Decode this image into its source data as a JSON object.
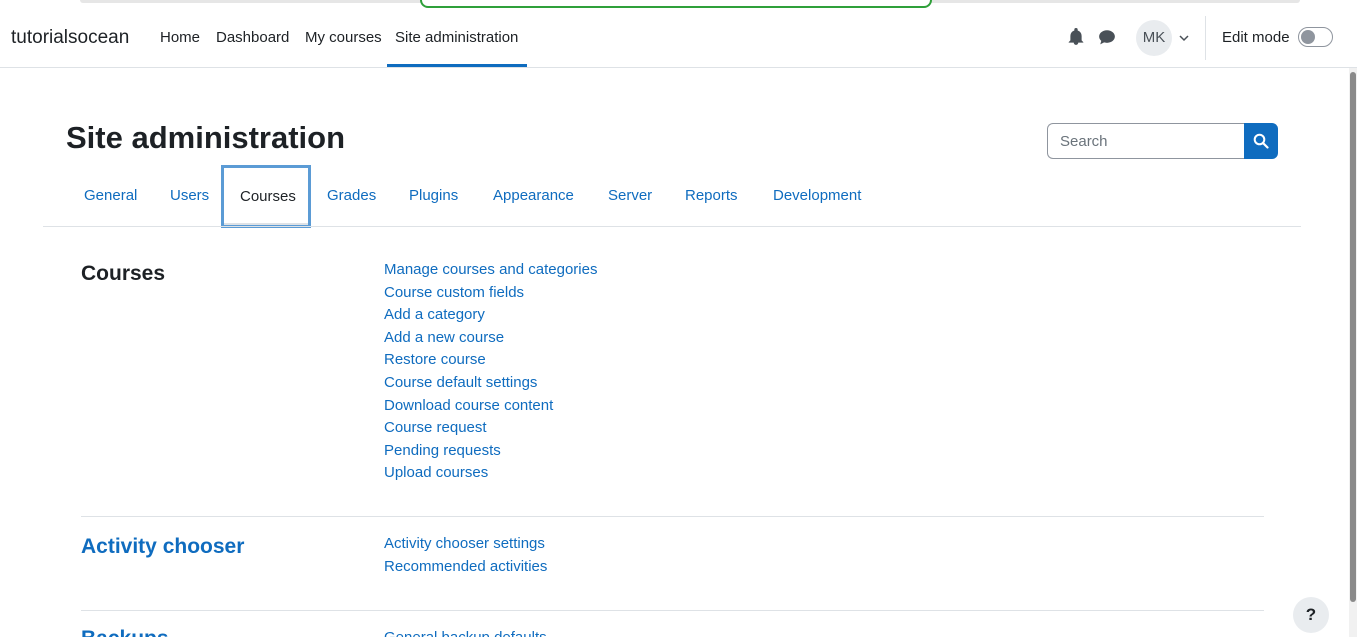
{
  "navbar": {
    "brand": "tutorialsocean",
    "items": [
      {
        "label": "Home"
      },
      {
        "label": "Dashboard"
      },
      {
        "label": "My courses"
      },
      {
        "label": "Site administration"
      }
    ],
    "active_item": "Site administration",
    "avatar_initials": "MK",
    "edit_mode_label": "Edit mode",
    "edit_mode_on": false,
    "icons": [
      "bell-icon",
      "chat-icon",
      "chevron-down-icon"
    ]
  },
  "page": {
    "title": "Site administration",
    "search_placeholder": "Search"
  },
  "tabs": [
    {
      "label": "General"
    },
    {
      "label": "Users"
    },
    {
      "label": "Courses"
    },
    {
      "label": "Grades"
    },
    {
      "label": "Plugins"
    },
    {
      "label": "Appearance"
    },
    {
      "label": "Server"
    },
    {
      "label": "Reports"
    },
    {
      "label": "Development"
    }
  ],
  "active_tab": "Courses",
  "sections": [
    {
      "title": "Courses",
      "title_is_link": false,
      "links": [
        "Manage courses and categories",
        "Course custom fields",
        "Add a category",
        "Add a new course",
        "Restore course",
        "Course default settings",
        "Download course content",
        "Course request",
        "Pending requests",
        "Upload courses"
      ]
    },
    {
      "title": "Activity chooser",
      "title_is_link": true,
      "links": [
        "Activity chooser settings",
        "Recommended activities"
      ]
    },
    {
      "title": "Backups",
      "title_is_link": true,
      "links": [
        "General backup defaults"
      ]
    }
  ],
  "help_label": "?",
  "colors": {
    "link": "#0f6cbf",
    "text": "#1d2125",
    "border": "#dee2e6",
    "active_tab_outline": "#5b9bd5"
  }
}
